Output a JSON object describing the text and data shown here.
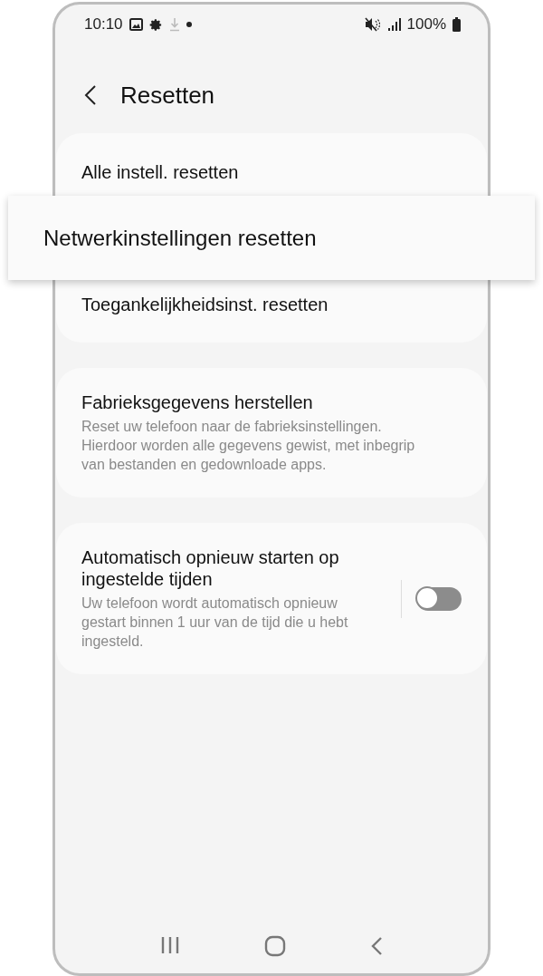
{
  "status_bar": {
    "time": "10:10",
    "battery": "100%"
  },
  "header": {
    "title": "Resetten"
  },
  "groups": [
    {
      "items": [
        {
          "kind": "plain",
          "title": "Alle instell. resetten",
          "highlighted": false
        },
        {
          "kind": "plain",
          "title": "Netwerkinstellingen resetten",
          "highlighted": true
        },
        {
          "kind": "plain",
          "title": "Toegankelijkheidsinst. resetten",
          "highlighted": false
        }
      ]
    },
    {
      "items": [
        {
          "kind": "plain",
          "title": "Fabrieksgegevens herstellen",
          "description": "Reset uw telefoon naar de fabrieksinstellingen. Hierdoor worden alle gegevens gewist, met inbegrip van bestanden en gedownloade apps.",
          "highlighted": false
        }
      ]
    },
    {
      "items": [
        {
          "kind": "switch",
          "title": "Automatisch opnieuw starten op ingestelde tijden",
          "description": "Uw telefoon wordt automatisch opnieuw gestart binnen 1 uur van de tijd die u hebt ingesteld.",
          "highlighted": false,
          "on": false
        }
      ]
    }
  ]
}
